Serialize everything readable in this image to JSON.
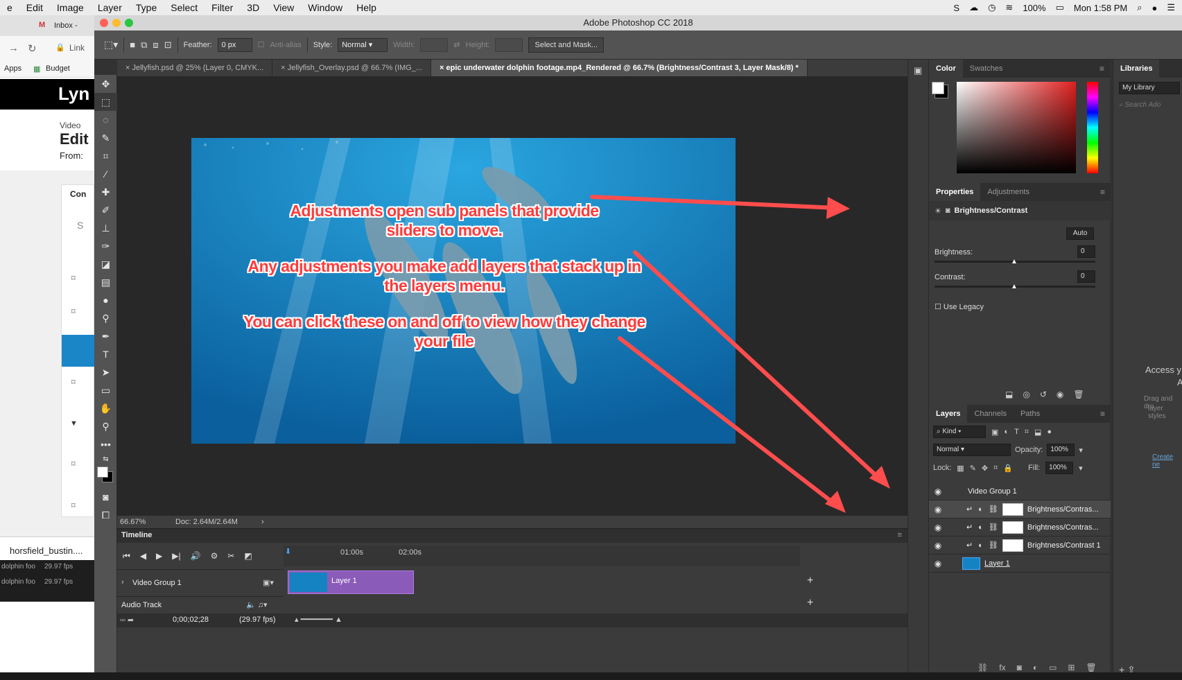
{
  "menubar": {
    "items": [
      "e",
      "Edit",
      "Image",
      "Layer",
      "Type",
      "Select",
      "Filter",
      "3D",
      "View",
      "Window",
      "Help"
    ],
    "battery": "100%",
    "clock": "Mon 1:58 PM"
  },
  "chrome": {
    "tab": "Inbox -",
    "address": "Link",
    "apps": "Apps",
    "budget": "Budget",
    "logo": "Lyn",
    "video": "Video",
    "edit": "Edit",
    "from": "From:",
    "con": "Con",
    "s": "S",
    "download": "horsfield_bustin....",
    "files": [
      {
        "name": "dolphin foo",
        "fps": "29.97 fps"
      },
      {
        "name": "dolphin foo",
        "fps": "29.97 fps"
      }
    ]
  },
  "ps": {
    "title": "Adobe Photoshop CC 2018",
    "options": {
      "feather_label": "Feather:",
      "feather_value": "0 px",
      "antialias": "Anti-alias",
      "style_label": "Style:",
      "style_value": "Normal",
      "width_label": "Width:",
      "height_label": "Height:",
      "select_mask": "Select and Mask..."
    },
    "tabs": [
      "Jellyfish.psd @ 25% (Layer 0, CMYK...",
      "Jellyfish_Overlay.psd @ 66.7% (IMG_...",
      "epic underwater dolphin footage.mp4_Rendered @ 66.7% (Brightness/Contrast 3, Layer Mask/8) *"
    ],
    "status": {
      "zoom": "66.67%",
      "doc": "Doc: 2.64M/2.64M"
    },
    "annotations": [
      "Adjustments open sub panels that provide sliders to move.",
      "Any adjustments you make add layers that stack up in the layers menu.",
      "You can click these on and off to view how they change your file"
    ],
    "timeline": {
      "title": "Timeline",
      "marks": [
        "01:00s",
        "02:00s"
      ],
      "video_group": "Video Group 1",
      "clip": "Layer 1",
      "audio": "Audio Track",
      "timecode": "0;00;02;28",
      "fps": "(29.97 fps)"
    },
    "color": {
      "tabs": [
        "Color",
        "Swatches"
      ]
    },
    "properties": {
      "tabs": [
        "Properties",
        "Adjustments"
      ],
      "title": "Brightness/Contrast",
      "auto": "Auto",
      "brightness_label": "Brightness:",
      "brightness_value": "0",
      "contrast_label": "Contrast:",
      "contrast_value": "0",
      "legacy": "Use Legacy"
    },
    "layers": {
      "tabs": [
        "Layers",
        "Channels",
        "Paths"
      ],
      "kind": "Kind",
      "blend": "Normal",
      "opacity_label": "Opacity:",
      "opacity": "100%",
      "lock_label": "Lock:",
      "fill_label": "Fill:",
      "fill": "100%",
      "rows": [
        {
          "name": "Video Group 1"
        },
        {
          "name": "Brightness/Contras..."
        },
        {
          "name": "Brightness/Contras..."
        },
        {
          "name": "Brightness/Contrast 1"
        },
        {
          "name": "Layer 1"
        }
      ]
    },
    "libraries": {
      "title": "Libraries",
      "library": "My Library",
      "search": "Search Ado",
      "access": "Access y",
      "access2": "A",
      "drag": "Drag and dro",
      "styles": "layer styles",
      "create": "Create ne"
    }
  }
}
